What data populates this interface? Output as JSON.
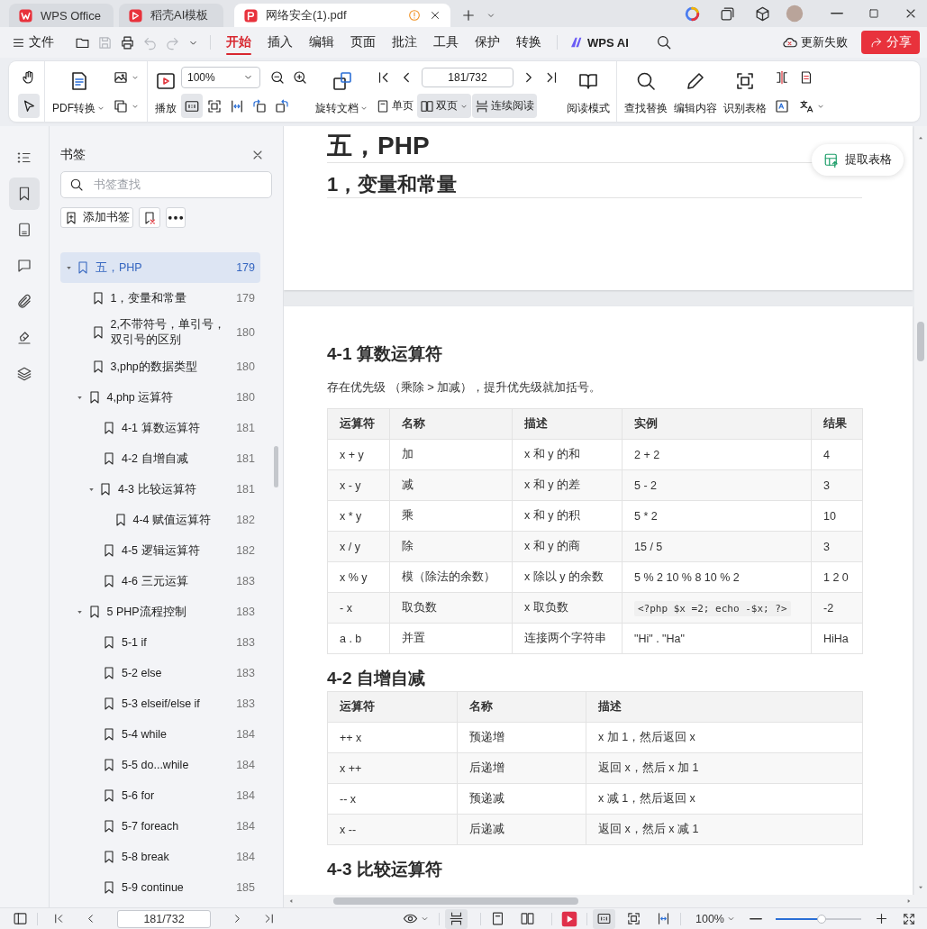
{
  "tabs": [
    {
      "label": "WPS Office",
      "selected": false
    },
    {
      "label": "稻壳AI模板",
      "selected": false
    },
    {
      "label": "网络安全(1).pdf",
      "selected": true
    }
  ],
  "menu": {
    "file": "文件",
    "tabs": [
      {
        "label": "开始",
        "selected": true
      },
      {
        "label": "插入",
        "selected": false
      },
      {
        "label": "编辑",
        "selected": false
      },
      {
        "label": "页面",
        "selected": false
      },
      {
        "label": "批注",
        "selected": false
      },
      {
        "label": "工具",
        "selected": false
      },
      {
        "label": "保护",
        "selected": false
      },
      {
        "label": "转换",
        "selected": false
      }
    ],
    "ai": "WPS AI",
    "update_status": "更新失败",
    "share": "分享"
  },
  "ribbon": [
    {
      "columns": [
        {
          "rows": [
            [
              {
                "kind": "icon",
                "selected": false
              }
            ],
            [
              {
                "kind": "icon",
                "selected": true
              }
            ]
          ]
        }
      ]
    },
    {
      "columns": [
        {
          "rows": [
            [
              {
                "kind": "big",
                "label": "PDF转换",
                "dropdown": true
              }
            ]
          ]
        },
        {
          "rows": [
            [
              {
                "kind": "icon",
                "dropdown": true
              }
            ],
            [
              {
                "kind": "icon",
                "dropdown": true
              }
            ]
          ]
        }
      ]
    },
    {
      "columns": [
        {
          "rows": [
            [
              {
                "kind": "big",
                "label": "播放"
              }
            ]
          ]
        },
        {
          "rows": [
            [
              {
                "kind": "select",
                "value": "100%"
              },
              {
                "kind": "icon"
              },
              {
                "kind": "icon"
              }
            ],
            [
              {
                "kind": "icon",
                "selected": true
              },
              {
                "kind": "icon"
              },
              {
                "kind": "icon"
              },
              {
                "kind": "icon"
              },
              {
                "kind": "icon"
              }
            ]
          ]
        },
        {
          "rows": [
            [
              {
                "kind": "big",
                "label": "旋转文档",
                "dropdown": true
              }
            ]
          ]
        },
        {
          "rows": [
            [
              {
                "kind": "icon"
              },
              {
                "kind": "icon"
              },
              {
                "kind": "page",
                "value": "181/732"
              },
              {
                "kind": "icon"
              },
              {
                "kind": "icon"
              }
            ],
            [
              {
                "kind": "inline",
                "label": "单页",
                "selected": false
              },
              {
                "kind": "inline",
                "label": "双页",
                "selected": true,
                "dropdown": true
              },
              {
                "kind": "inline",
                "label": "连续阅读",
                "selected": true
              }
            ]
          ]
        },
        {
          "rows": [
            [
              {
                "kind": "big",
                "label": "阅读模式"
              }
            ]
          ]
        }
      ]
    },
    {
      "columns": [
        {
          "rows": [
            [
              {
                "kind": "big",
                "label": "查找替换"
              }
            ]
          ]
        },
        {
          "rows": [
            [
              {
                "kind": "big",
                "label": "编辑内容"
              }
            ]
          ]
        },
        {
          "rows": [
            [
              {
                "kind": "big",
                "label": "识别表格"
              }
            ]
          ]
        },
        {
          "rows": [
            [
              {
                "kind": "icon"
              }
            ],
            [
              {
                "kind": "icon"
              }
            ]
          ]
        },
        {
          "rows": [
            [
              {
                "kind": "icon"
              }
            ],
            [
              {
                "kind": "icon",
                "dropdown": true
              }
            ]
          ]
        }
      ]
    }
  ],
  "rail": [
    {
      "selected": false
    },
    {
      "selected": true
    },
    {
      "selected": false
    },
    {
      "selected": false
    },
    {
      "selected": false
    },
    {
      "selected": false
    },
    {
      "selected": false
    }
  ],
  "bookmarks": {
    "title": "书签",
    "search_placeholder": "书签查找",
    "add_button": "添加书签",
    "items": [
      {
        "label": "五，PHP",
        "page": "179",
        "selected": true,
        "expanded": true,
        "children": [
          {
            "label": "1，变量和常量",
            "page": "179",
            "selected": false
          },
          {
            "label": "2,不带符号，单引号，双引号的区别",
            "page": "180",
            "selected": false
          },
          {
            "label": "3,php的数据类型",
            "page": "180",
            "selected": false
          },
          {
            "label": "4,php 运算符",
            "page": "180",
            "selected": false,
            "expanded": true,
            "children": [
              {
                "label": "4-1 算数运算符",
                "page": "181",
                "selected": false
              },
              {
                "label": "4-2 自增自减",
                "page": "181",
                "selected": false
              },
              {
                "label": "4-3 比较运算符",
                "page": "181",
                "selected": false,
                "expanded": true,
                "children": [
                  {
                    "label": "4-4 赋值运算符",
                    "page": "182",
                    "selected": false
                  }
                ]
              },
              {
                "label": "4-5 逻辑运算符",
                "page": "182",
                "selected": false
              },
              {
                "label": "4-6 三元运算",
                "page": "183",
                "selected": false
              }
            ]
          },
          {
            "label": "5 PHP流程控制",
            "page": "183",
            "selected": false,
            "expanded": true,
            "children": [
              {
                "label": "5-1 if",
                "page": "183",
                "selected": false
              },
              {
                "label": "5-2 else",
                "page": "183",
                "selected": false
              },
              {
                "label": "5-3 elseif/else if",
                "page": "183",
                "selected": false
              },
              {
                "label": "5-4 while",
                "page": "184",
                "selected": false
              },
              {
                "label": "5-5 do...while",
                "page": "184",
                "selected": false
              },
              {
                "label": "5-6 for",
                "page": "184",
                "selected": false
              },
              {
                "label": "5-7 foreach",
                "page": "184",
                "selected": false
              },
              {
                "label": "5-8 break",
                "page": "184",
                "selected": false
              },
              {
                "label": "5-9 continue",
                "page": "185",
                "selected": false
              }
            ]
          }
        ]
      }
    ]
  },
  "document": {
    "extract_button": "提取表格",
    "pages": [
      {
        "blocks": [
          {
            "kind": "h1",
            "text": "五，PHP"
          },
          {
            "kind": "h2",
            "text": "1，变量和常量"
          }
        ]
      },
      {
        "blocks": [
          {
            "kind": "h3",
            "text": "4-1 算数运算符"
          },
          {
            "kind": "paragraph",
            "text": "存在优先级 （乘除 > 加减），提升优先级就加括号。"
          },
          {
            "kind": "table",
            "columns": [
              "运算符",
              "名称",
              "描述",
              "实例",
              "结果"
            ],
            "rows": [
              [
                "x + y",
                "加",
                "x 和 y 的和",
                "2 + 2",
                "4"
              ],
              [
                "x - y",
                "减",
                "x 和 y 的差",
                "5 - 2",
                "3"
              ],
              [
                "x * y",
                "乘",
                "x 和 y 的积",
                "5 * 2",
                "10"
              ],
              [
                "x / y",
                "除",
                "x 和 y 的商",
                "15 / 5",
                "3"
              ],
              [
                "x % y",
                "模（除法的余数）",
                "x 除以 y 的余数",
                "5 % 2 10 % 8 10 % 2",
                "1 2 0"
              ],
              [
                "- x",
                "取负数",
                "x 取负数",
                {
                  "kind": "code",
                  "text": "<?php $x =2; echo -$x; ?>"
                },
                "-2"
              ],
              [
                "a . b",
                "并置",
                "连接两个字符串",
                "\"Hi\" . \"Ha\"",
                "HiHa"
              ]
            ]
          },
          {
            "kind": "h3",
            "text": "4-2 自增自减"
          },
          {
            "kind": "table",
            "columns": [
              "运算符",
              "名称",
              "描述"
            ],
            "rows": [
              [
                "++ x",
                "预递增",
                "x 加 1，然后返回 x"
              ],
              [
                "x ++",
                "后递增",
                "返回 x，然后 x 加 1"
              ],
              [
                "-- x",
                "预递减",
                "x 减 1，然后返回 x"
              ],
              [
                "x --",
                "后递减",
                "返回 x，然后 x 减 1"
              ]
            ]
          },
          {
            "kind": "h3",
            "text": "4-3 比较运算符"
          }
        ]
      }
    ]
  },
  "status_bar": {
    "page": "181/732",
    "zoom": "100%",
    "zoom_slider": {
      "level": 0.54
    },
    "view_modes": [
      {
        "selected": true
      },
      {
        "selected": false
      },
      {
        "selected": false
      }
    ],
    "actual_size": {
      "selected": true
    }
  }
}
